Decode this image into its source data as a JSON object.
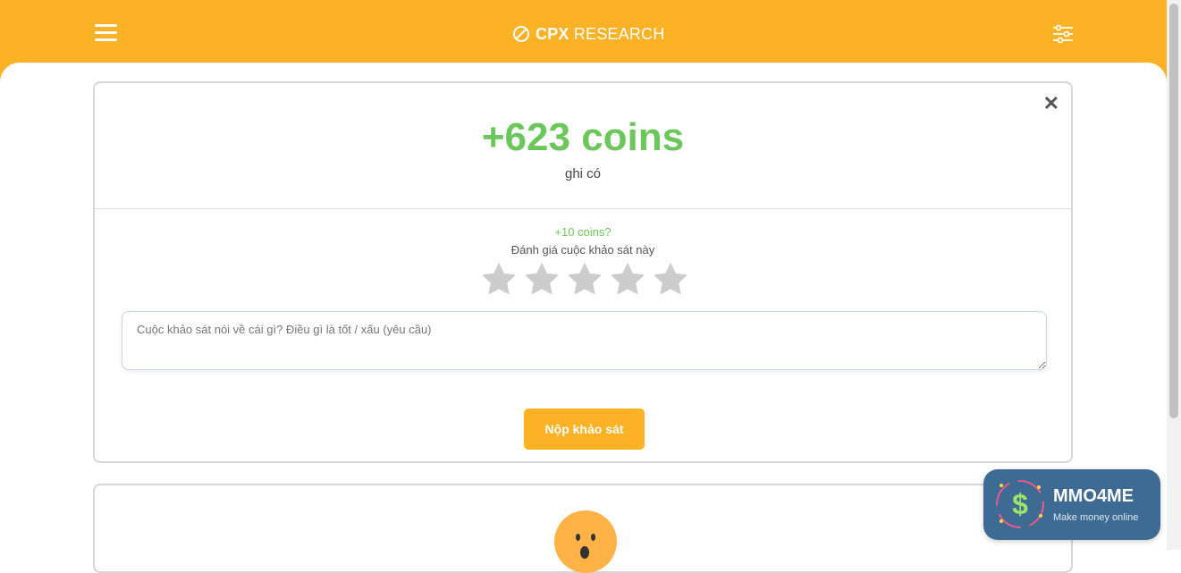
{
  "header": {
    "menu_icon": "hamburger-menu-icon",
    "logo_bold": "CPX",
    "logo_light": " RESEARCH",
    "filter_icon": "sliders-icon",
    "brand_color": "#fdb124"
  },
  "reward": {
    "amount": "+623 coins",
    "subtitle": "ghi có",
    "color": "#6cc75b"
  },
  "rating": {
    "bonus": "+10 coins?",
    "label": "Đánh giá cuộc khảo sát này",
    "stars_total": 5,
    "stars_selected": 0
  },
  "feedback": {
    "placeholder": "Cuộc khảo sát nói về cái gì? Điều gì là tốt / xấu (yêu cầu)"
  },
  "submit": {
    "label": "Nộp khảo sát"
  },
  "watermark": {
    "title": "MMO4ME",
    "subtitle": "Make money online"
  }
}
